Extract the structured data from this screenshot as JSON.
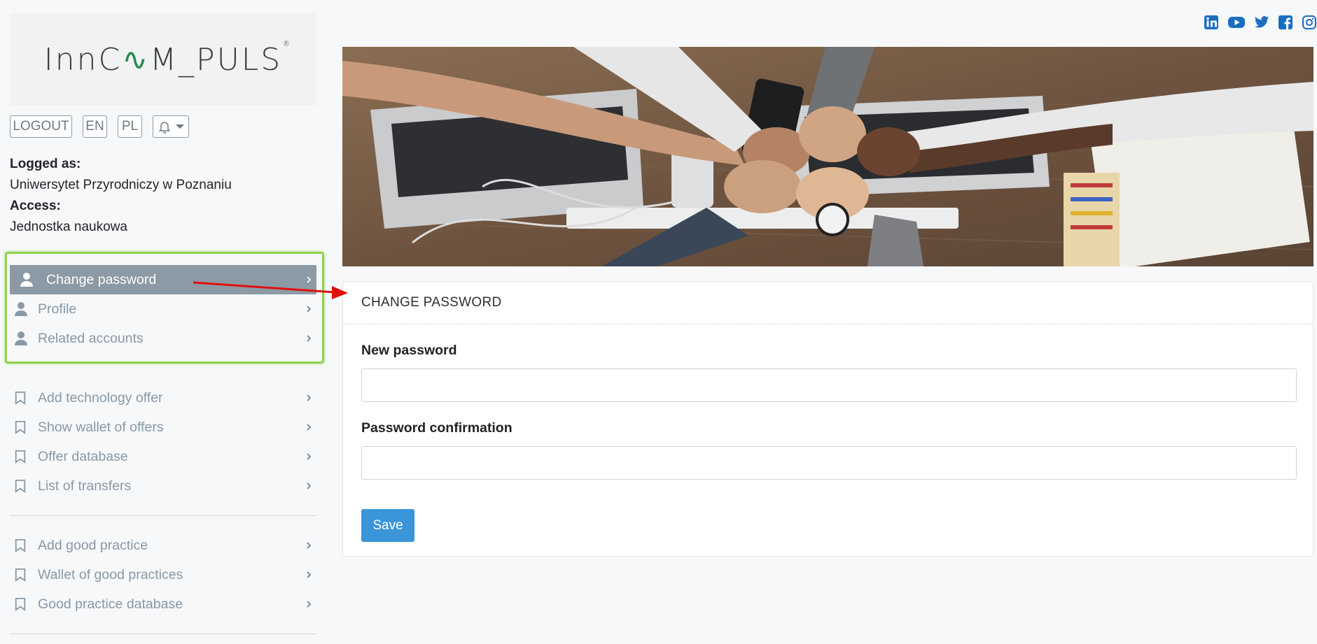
{
  "logo": {
    "text_left": "Inn",
    "text_c": "C",
    "text_swirl": "∿",
    "text_right": "M_PULS",
    "registered": "®"
  },
  "top_buttons": {
    "logout": "LOGOUT",
    "en": "EN",
    "pl": "PL",
    "bell_icon": "bell-icon"
  },
  "login": {
    "logged_label": "Logged as:",
    "logged_value": "Uniwersytet Przyrodniczy w Poznaniu",
    "access_label": "Access:",
    "access_value": "Jednostka naukowa"
  },
  "account_menu": [
    {
      "label": "Change password",
      "icon": "user-icon",
      "active": true
    },
    {
      "label": "Profile",
      "icon": "user-icon",
      "active": false
    },
    {
      "label": "Related accounts",
      "icon": "user-icon",
      "active": false
    }
  ],
  "offers_menu": [
    {
      "label": "Add technology offer",
      "icon": "bookmark-icon"
    },
    {
      "label": "Show wallet of offers",
      "icon": "bookmark-icon"
    },
    {
      "label": "Offer database",
      "icon": "bookmark-icon"
    },
    {
      "label": "List of transfers",
      "icon": "bookmark-icon"
    }
  ],
  "practice_menu": [
    {
      "label": "Add good practice",
      "icon": "bookmark-icon"
    },
    {
      "label": "Wallet of good practices",
      "icon": "bookmark-icon"
    },
    {
      "label": "Good practice database",
      "icon": "bookmark-icon"
    }
  ],
  "social": [
    "linkedin-icon",
    "youtube-icon",
    "twitter-icon",
    "facebook-icon",
    "instagram-icon"
  ],
  "form": {
    "title": "CHANGE PASSWORD",
    "new_password_label": "New password",
    "new_password_value": "",
    "confirm_label": "Password confirmation",
    "confirm_value": "",
    "save_label": "Save"
  },
  "colors": {
    "active_menu_bg": "#8c9aa5",
    "highlight_border": "#8ed24c",
    "save_button": "#3a95d9",
    "social_icons": "#1a6ec0",
    "annotation_arrow": "#e01010"
  }
}
